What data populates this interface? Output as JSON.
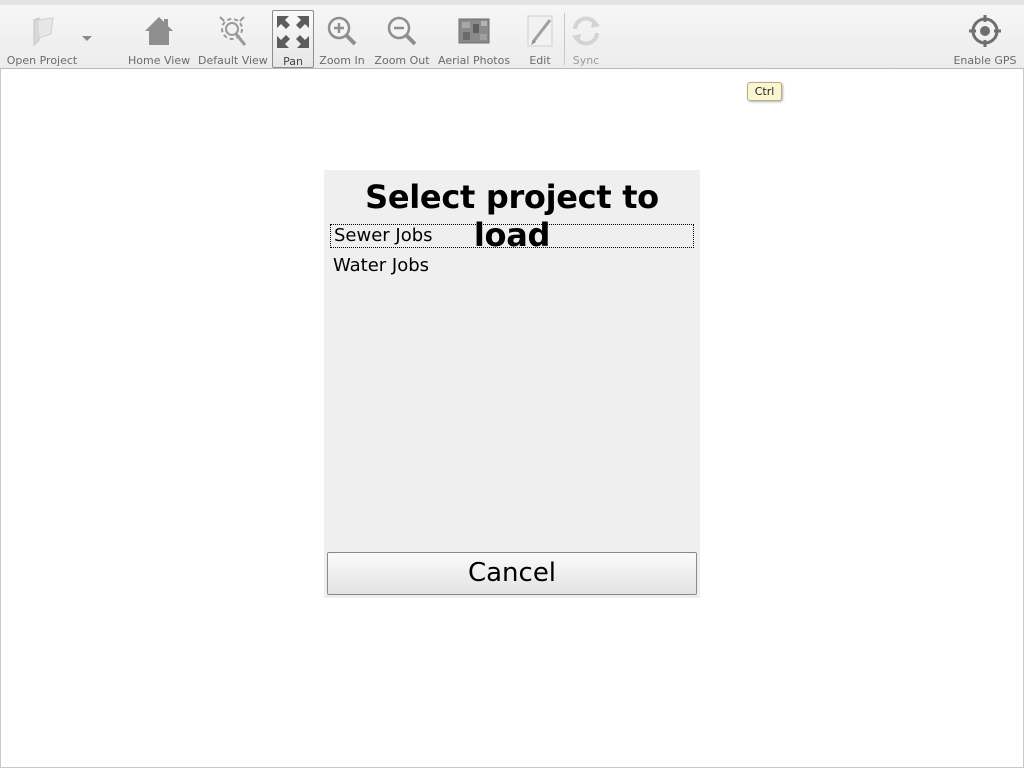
{
  "toolbar": {
    "buttons": [
      {
        "label": "Open Project",
        "icon": "open-project-icon"
      },
      {
        "label": "Home View",
        "icon": "home-icon"
      },
      {
        "label": "Default View",
        "icon": "default-view-icon"
      },
      {
        "label": "Pan",
        "icon": "pan-icon",
        "active": true
      },
      {
        "label": "Zoom In",
        "icon": "zoom-in-icon"
      },
      {
        "label": "Zoom Out",
        "icon": "zoom-out-icon"
      },
      {
        "label": "Aerial Photos",
        "icon": "aerial-photos-icon"
      },
      {
        "label": "Edit",
        "icon": "edit-icon"
      },
      {
        "label": "Sync",
        "icon": "sync-icon",
        "disabled": true
      },
      {
        "label": "Enable GPS",
        "icon": "gps-icon"
      }
    ]
  },
  "tooltip": {
    "text": "Ctrl"
  },
  "dialog": {
    "title": "Select project to load",
    "projects": [
      {
        "name": "Sewer Jobs",
        "focused": true
      },
      {
        "name": "Water Jobs",
        "focused": false
      }
    ],
    "cancel_label": "Cancel"
  }
}
